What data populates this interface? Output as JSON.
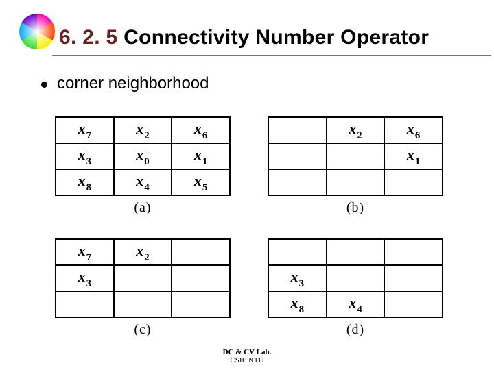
{
  "header": {
    "section_number": "6. 2. 5",
    "title_rest": " Connectivity Number Operator"
  },
  "bullet": "corner neighborhood",
  "tables": {
    "a": {
      "caption": "(a)",
      "cells": [
        [
          "x7",
          "x2",
          "x6"
        ],
        [
          "x3",
          "x0",
          "x1"
        ],
        [
          "x8",
          "x4",
          "x5"
        ]
      ]
    },
    "b": {
      "caption": "(b)",
      "cells": [
        [
          "",
          "x2",
          "x6"
        ],
        [
          "",
          "",
          "x1"
        ],
        [
          "",
          "",
          ""
        ]
      ]
    },
    "c": {
      "caption": "(c)",
      "cells": [
        [
          "x7",
          "x2",
          ""
        ],
        [
          "x3",
          "",
          ""
        ],
        [
          "",
          "",
          ""
        ]
      ]
    },
    "d": {
      "caption": "(d)",
      "cells": [
        [
          "",
          "",
          ""
        ],
        [
          "x3",
          "",
          ""
        ],
        [
          "x8",
          "x4",
          ""
        ]
      ]
    }
  },
  "footer": {
    "line1": "DC & CV Lab.",
    "line2": "CSIE NTU"
  }
}
